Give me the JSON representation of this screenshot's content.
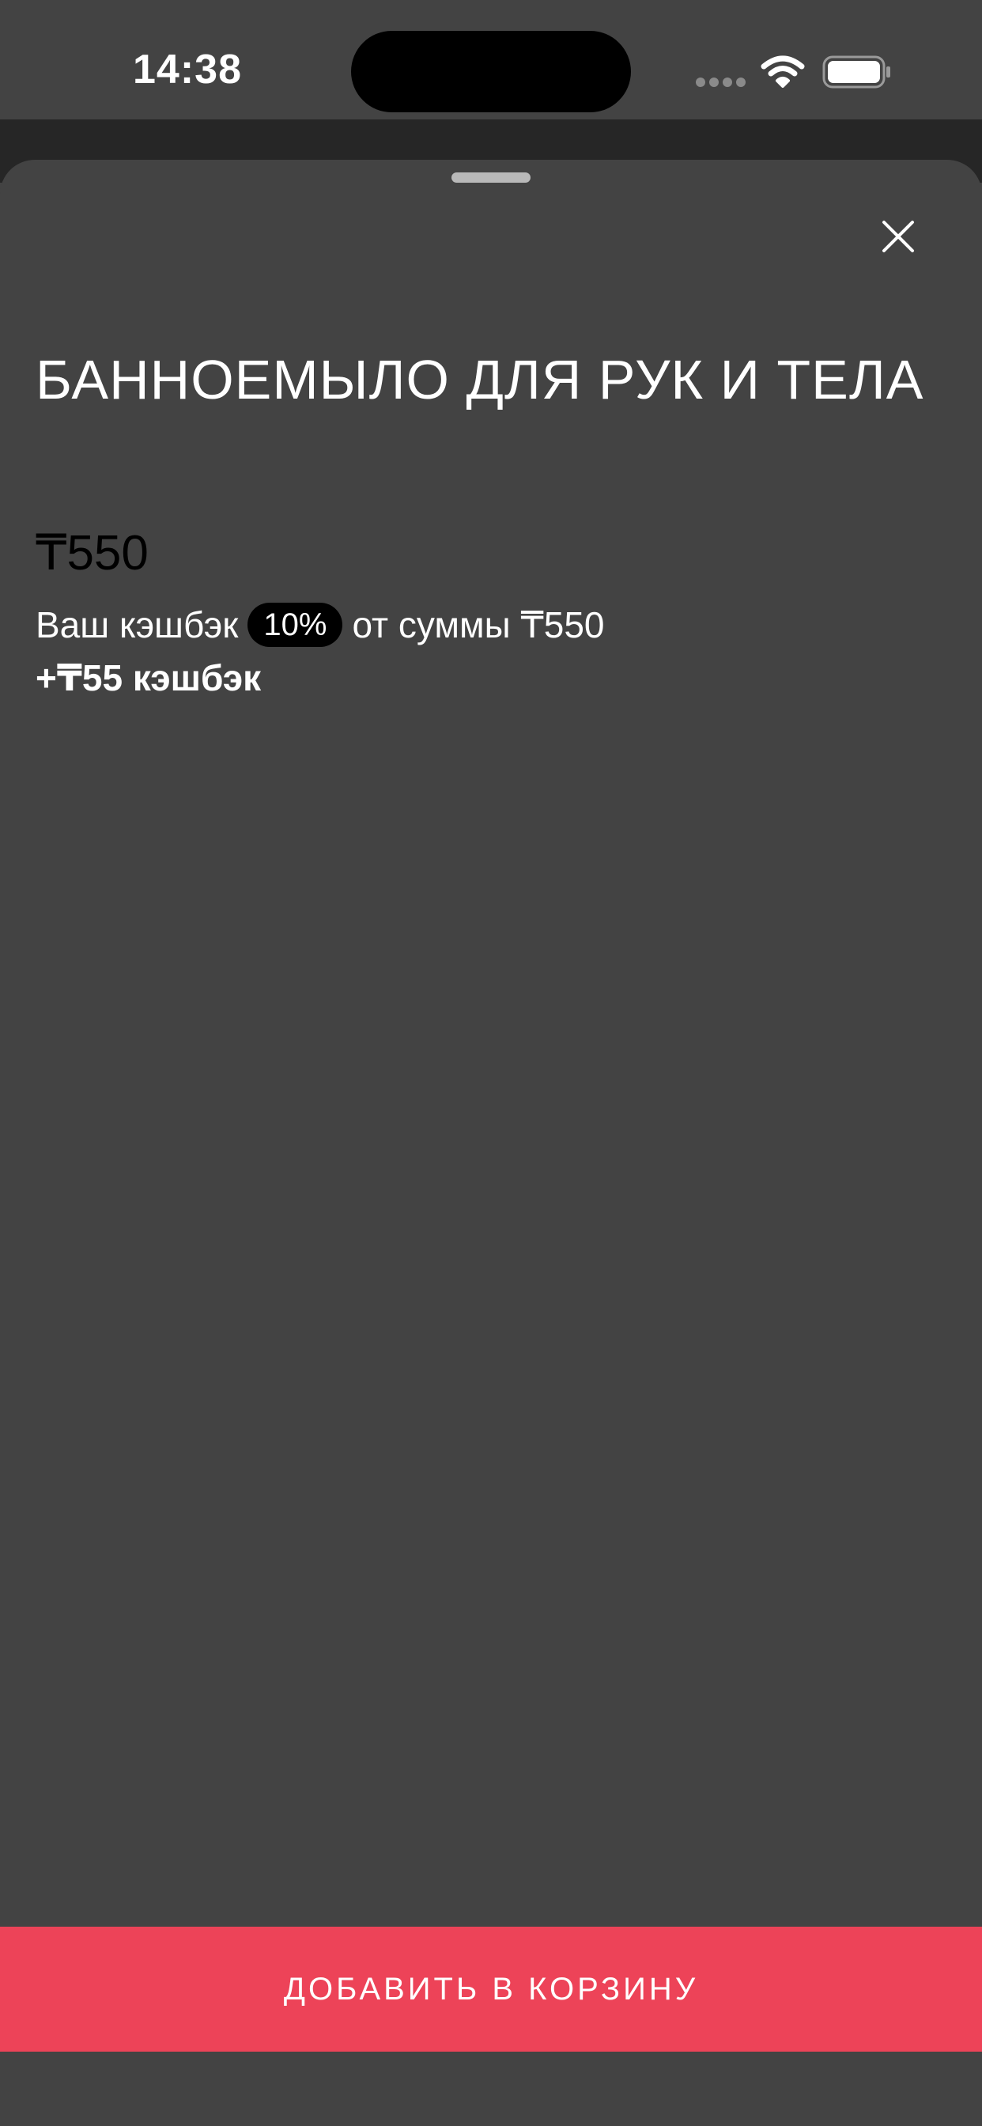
{
  "status_bar": {
    "time": "14:38",
    "icons": [
      "signal-dots-icon",
      "wifi-icon",
      "battery-icon"
    ]
  },
  "sheet": {
    "close_icon": "close-icon"
  },
  "product": {
    "title": "БАННОЕМЫЛО ДЛЯ РУК И ТЕЛА",
    "price": "₸550"
  },
  "cashback": {
    "prefix": "Ваш кэшбэк",
    "percent": "10%",
    "suffix": "от суммы ₸550",
    "amount": "+₸55 кэшбэк"
  },
  "actions": {
    "add_to_cart_label": "ДОБАВИТЬ В КОРЗИНУ"
  },
  "colors": {
    "background": "#434343",
    "accent": "#ed4358",
    "badge": "#000000"
  }
}
